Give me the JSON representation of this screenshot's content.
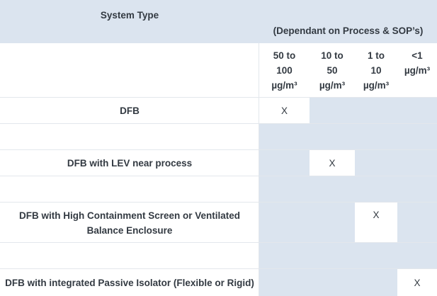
{
  "header": {
    "system_type": "System Type",
    "dependant": "(Dependant on Process & SOP’s)",
    "bands": [
      [
        "50 to",
        "100",
        "µg/m³"
      ],
      [
        "10 to",
        "50",
        "µg/m³"
      ],
      [
        "1 to",
        "10",
        "µg/m³"
      ],
      [
        "<1",
        "µg/m³"
      ]
    ]
  },
  "rows": [
    {
      "label": "DFB",
      "marks": [
        "X",
        "",
        "",
        ""
      ]
    },
    {
      "label": "",
      "marks": [
        "",
        "",
        "",
        ""
      ]
    },
    {
      "label": "DFB with LEV near process",
      "marks": [
        "",
        "X",
        "",
        ""
      ]
    },
    {
      "label": "",
      "marks": [
        "",
        "",
        "",
        ""
      ]
    },
    {
      "label_lines": [
        "DFB with High Containment Screen or Ventilated",
        "Balance Enclosure"
      ],
      "marks": [
        "",
        "",
        "X",
        ""
      ]
    },
    {
      "label": "",
      "marks": [
        "",
        "",
        "",
        ""
      ]
    },
    {
      "label": "DFB with integrated Passive Isolator (Flexible or Rigid)",
      "marks": [
        "",
        "",
        "",
        "X"
      ]
    }
  ],
  "colors": {
    "shaded": "#dbe4ef",
    "text": "#333a42"
  }
}
